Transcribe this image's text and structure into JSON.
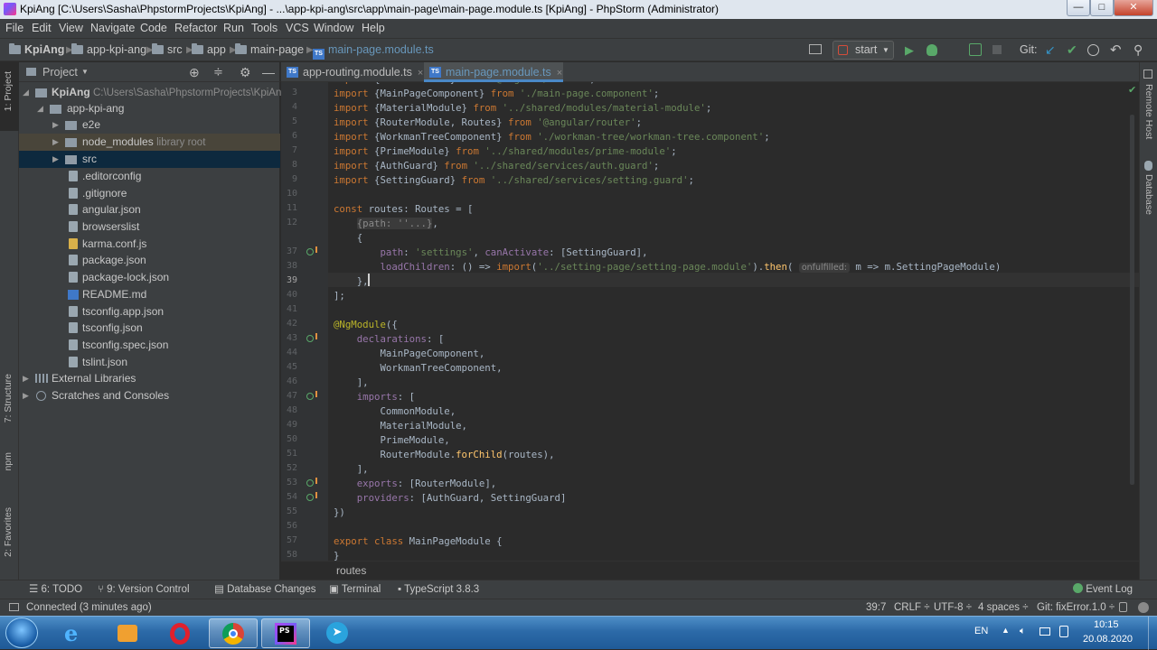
{
  "window": {
    "title": "KpiAng [C:\\Users\\Sasha\\PhpstormProjects\\KpiAng] - ...\\app-kpi-ang\\src\\app\\main-page\\main-page.module.ts [KpiAng] - PhpStorm (Administrator)",
    "minimize": "—",
    "maximize": "□",
    "close": "✕"
  },
  "menu": [
    "File",
    "Edit",
    "View",
    "Navigate",
    "Code",
    "Refactor",
    "Run",
    "Tools",
    "VCS",
    "Window",
    "Help"
  ],
  "nav": {
    "crumbs": [
      "KpiAng",
      "app-kpi-ang",
      "src",
      "app",
      "main-page",
      "main-page.module.ts"
    ],
    "run_config": "start",
    "git_label": "Git:"
  },
  "left_tabs": {
    "project": "1: Project",
    "structure": "7: Structure",
    "npm": "npm",
    "favorites": "2: Favorites"
  },
  "project": {
    "header": "Project",
    "root_name": "KpiAng",
    "root_path": "C:\\Users\\Sasha\\PhpstormProjects\\KpiAng",
    "items": [
      {
        "label": "app-kpi-ang",
        "hint": ""
      },
      {
        "label": "e2e",
        "hint": ""
      },
      {
        "label": "node_modules",
        "hint": "library root"
      },
      {
        "label": "src",
        "hint": ""
      },
      {
        "label": ".editorconfig",
        "hint": ""
      },
      {
        "label": ".gitignore",
        "hint": ""
      },
      {
        "label": "angular.json",
        "hint": ""
      },
      {
        "label": "browserslist",
        "hint": ""
      },
      {
        "label": "karma.conf.js",
        "hint": ""
      },
      {
        "label": "package.json",
        "hint": ""
      },
      {
        "label": "package-lock.json",
        "hint": ""
      },
      {
        "label": "README.md",
        "hint": ""
      },
      {
        "label": "tsconfig.app.json",
        "hint": ""
      },
      {
        "label": "tsconfig.json",
        "hint": ""
      },
      {
        "label": "tsconfig.spec.json",
        "hint": ""
      },
      {
        "label": "tslint.json",
        "hint": ""
      },
      {
        "label": "External Libraries",
        "hint": ""
      },
      {
        "label": "Scratches and Consoles",
        "hint": ""
      }
    ]
  },
  "tabs": [
    {
      "label": "app-routing.module.ts",
      "close": "×"
    },
    {
      "label": "main-page.module.ts",
      "close": "×"
    }
  ],
  "editor": {
    "line_numbers": [
      "3",
      "4",
      "5",
      "6",
      "7",
      "8",
      "9",
      "10",
      "11",
      "12",
      "37",
      "38",
      "39",
      "40",
      "41",
      "42",
      "43",
      "44",
      "45",
      "46",
      "47",
      "48",
      "49",
      "50",
      "51",
      "52",
      "53",
      "54",
      "55",
      "56",
      "57",
      "58"
    ],
    "breadcrumb": "routes",
    "inlay_hint": "onfulfilled:"
  },
  "right_tabs": {
    "remote_host": "Remote Host",
    "database": "Database"
  },
  "tool_windows": {
    "todo": "6: TODO",
    "vcs": "9: Version Control",
    "db_changes": "Database Changes",
    "terminal": "Terminal",
    "typescript": "TypeScript 3.8.3",
    "event_log": "Event Log"
  },
  "status": {
    "message": "Connected (3 minutes ago)",
    "position": "39:7",
    "line_sep": "CRLF ÷",
    "encoding": "UTF-8 ÷",
    "indent": "4 spaces ÷",
    "branch": "Git: fixError.1.0 ÷"
  },
  "taskbar": {
    "lang": "EN",
    "time": "10:15",
    "date": "20.08.2020"
  },
  "colors": {
    "keyword": "#cc7832",
    "string": "#6a8759",
    "property": "#9876aa",
    "function": "#ffc66d",
    "annotation": "#bbb529",
    "ts_icon": "#3f78c8"
  }
}
